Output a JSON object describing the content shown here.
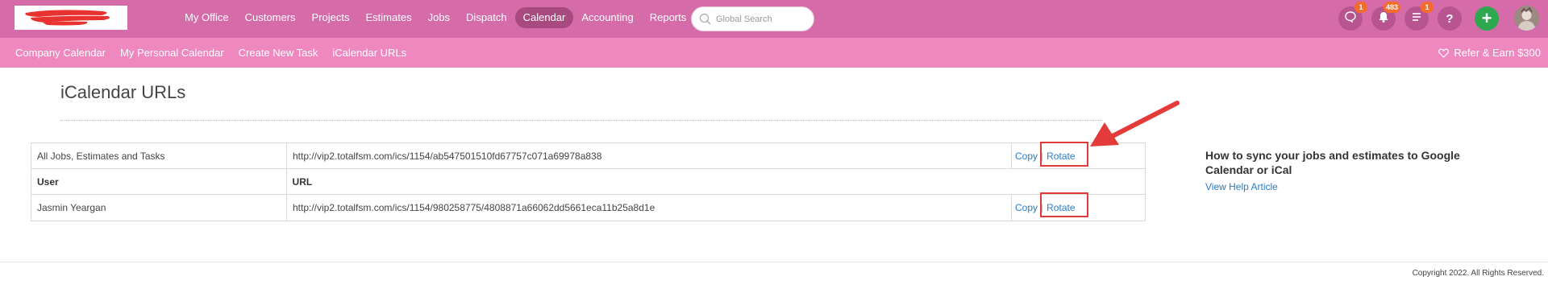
{
  "nav": {
    "items": [
      {
        "label": "My Office"
      },
      {
        "label": "Customers"
      },
      {
        "label": "Projects"
      },
      {
        "label": "Estimates"
      },
      {
        "label": "Jobs"
      },
      {
        "label": "Dispatch"
      },
      {
        "label": "Calendar",
        "active": true
      },
      {
        "label": "Accounting"
      },
      {
        "label": "Reports"
      }
    ],
    "search_placeholder": "Global Search",
    "icons": {
      "chat_badge": "1",
      "notifications_badge": "483",
      "tasks_badge": "1",
      "help_label": "?",
      "add_label": "+"
    },
    "colors": {
      "primary": "#d66baa",
      "secondary": "#ee88bf",
      "active": "#a8497f",
      "add": "#2ea84f",
      "badge": "#f56c2a"
    }
  },
  "subnav": {
    "items": [
      {
        "label": "Company Calendar"
      },
      {
        "label": "My Personal Calendar"
      },
      {
        "label": "Create New Task"
      },
      {
        "label": "iCalendar URLs"
      }
    ],
    "refer_label": "Refer & Earn $300"
  },
  "page": {
    "title": "iCalendar URLs"
  },
  "urls": {
    "all_row": {
      "user": "All Jobs, Estimates and Tasks",
      "url": "http://vip2.totalfsm.com/ics/1154/ab547501510fd67757c071a69978a838",
      "copy": "Copy",
      "rotate": "Rotate"
    },
    "headers": {
      "user": "User",
      "url": "URL"
    },
    "rows": [
      {
        "user": "Jasmin Yeargan",
        "url": "http://vip2.totalfsm.com/ics/1154/980258775/4808871a66062dd5661eca11b25a8d1e",
        "copy": "Copy",
        "rotate": "Rotate"
      }
    ]
  },
  "help": {
    "title": "How to sync your jobs and estimates to Google Calendar or iCal",
    "link": "View Help Article"
  },
  "footer": {
    "copyright": "Copyright 2022. All Rights Reserved."
  }
}
